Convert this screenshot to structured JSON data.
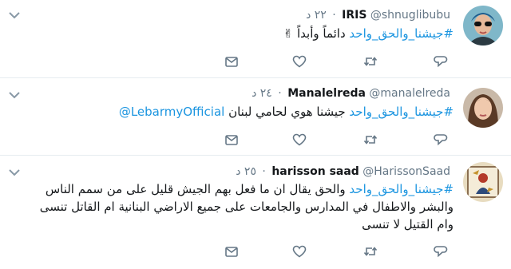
{
  "tweets": [
    {
      "name": "IRIS",
      "handle": "@shnuglibubu",
      "time": "٢٢ د",
      "hashtag": "#جيشنا_والحق_واحد",
      "text": " دائماً وأبداً ✌"
    },
    {
      "name": "Manalelreda",
      "handle": "@manalelreda",
      "time": "٢٤ د",
      "hashtag": "#جيشنا_والحق_واحد",
      "text": " جيشنا هوي لحامي لبنان ",
      "mention": "@LebarmyOfficial"
    },
    {
      "name": "harisson saad",
      "handle": "@HarissonSaad",
      "time": "٢٥ د",
      "hashtag": "#جيشنا_والحق_واحد",
      "line1": " والحق يقال ان ما فعل بهم الجيش قليل على من سمم الناس",
      "line2": "والبشر والاطفال في المدارس والجامعات على جميع الاراضي البنانية ام القاتل تنسى",
      "line3": "وام القتيل لا تنسى"
    }
  ],
  "colors": {
    "link": "#1b95e0",
    "muted": "#657786",
    "border": "#e6ecf0"
  },
  "icons": [
    "chevron-down-icon",
    "reply-icon",
    "retweet-icon",
    "like-icon",
    "message-icon"
  ]
}
